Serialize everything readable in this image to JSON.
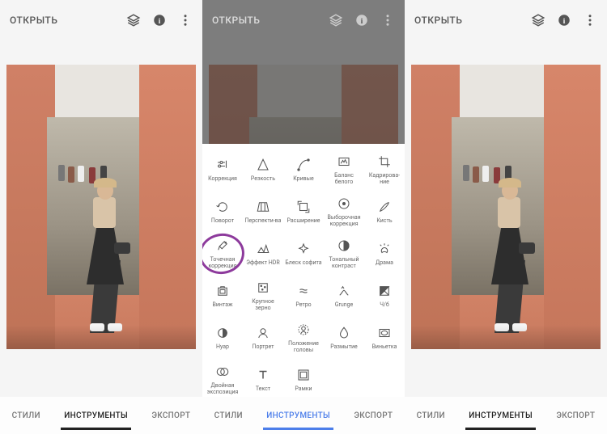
{
  "header": {
    "open_label": "ОТКРЫТЬ",
    "icons": [
      "stack-icon",
      "info-icon",
      "more-icon"
    ]
  },
  "tabs": {
    "styles": "СТИЛИ",
    "tools": "ИНСТРУМЕНТЫ",
    "export": "ЭКСПОРТ"
  },
  "tools": [
    {
      "id": "correction",
      "label": "Коррекция"
    },
    {
      "id": "sharpness",
      "label": "Резкость"
    },
    {
      "id": "curves",
      "label": "Кривые"
    },
    {
      "id": "white-balance",
      "label": "Баланс белого"
    },
    {
      "id": "crop",
      "label": "Кадрирова-ние"
    },
    {
      "id": "rotate",
      "label": "Поворот"
    },
    {
      "id": "perspective",
      "label": "Перспекти-ва"
    },
    {
      "id": "expand",
      "label": "Расширение"
    },
    {
      "id": "selective",
      "label": "Выборочная коррекция"
    },
    {
      "id": "brush",
      "label": "Кисть"
    },
    {
      "id": "healing",
      "label": "Точечная коррекция"
    },
    {
      "id": "hdr",
      "label": "Эффект HDR"
    },
    {
      "id": "glamour",
      "label": "Блеск софита"
    },
    {
      "id": "tonal",
      "label": "Тональный контраст"
    },
    {
      "id": "drama",
      "label": "Драма"
    },
    {
      "id": "vintage",
      "label": "Винтаж"
    },
    {
      "id": "grainy",
      "label": "Крупное зерно"
    },
    {
      "id": "retro",
      "label": "Ретро"
    },
    {
      "id": "grunge",
      "label": "Grunge"
    },
    {
      "id": "bw",
      "label": "Ч/б"
    },
    {
      "id": "noir",
      "label": "Нуар"
    },
    {
      "id": "portrait",
      "label": "Портрет"
    },
    {
      "id": "headpose",
      "label": "Положение головы"
    },
    {
      "id": "blur",
      "label": "Размытие"
    },
    {
      "id": "vignette",
      "label": "Виньетка"
    },
    {
      "id": "double-exp",
      "label": "Двойная экспозиция"
    },
    {
      "id": "text",
      "label": "Текст"
    },
    {
      "id": "frames",
      "label": "Рамки"
    }
  ],
  "highlighted_tool": "healing"
}
